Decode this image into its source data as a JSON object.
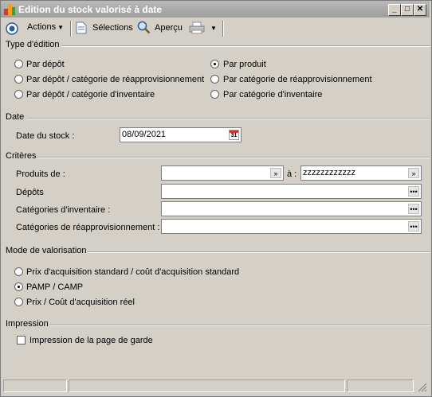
{
  "window": {
    "title": "Edition du stock valorisé à date"
  },
  "toolbar": {
    "actions": "Actions",
    "selections": "Sélections",
    "apercu": "Aperçu"
  },
  "type_edition": {
    "label": "Type d'édition",
    "options": [
      {
        "label": "Par dépôt",
        "checked": false
      },
      {
        "label": "Par dépôt / catégorie de réapprovisionnement",
        "checked": false
      },
      {
        "label": "Par dépôt / catégorie d'inventaire",
        "checked": false
      },
      {
        "label": "Par produit",
        "checked": true
      },
      {
        "label": "Par catégorie de réapprovisionnement",
        "checked": false
      },
      {
        "label": "Par catégorie d'inventaire",
        "checked": false
      }
    ]
  },
  "date": {
    "label": "Date",
    "field_label": "Date du stock :",
    "value": "08/09/2021",
    "calendar_text": "31"
  },
  "criteres": {
    "label": "Critères",
    "produits_label": "Produits de :",
    "produits_from": "",
    "a_label": "à :",
    "produits_to": "zzzzzzzzzzzz",
    "depots_label": "Dépôts",
    "depots_value": "",
    "cat_inv_label": "Catégories d'inventaire :",
    "cat_inv_value": "",
    "cat_reappro_label": "Catégories de réapprovisionnement :",
    "cat_reappro_value": "",
    "ellipsis": "•••"
  },
  "valorisation": {
    "label": "Mode de valorisation",
    "options": [
      {
        "label": "Prix d'acquisition standard / coût d'acquisition standard",
        "checked": false
      },
      {
        "label": "PAMP / CAMP",
        "checked": true
      },
      {
        "label": "Prix / Coût d'acquisition réel",
        "checked": false
      }
    ]
  },
  "impression": {
    "label": "Impression",
    "checkbox_label": "Impression de la page de garde",
    "checked": false
  }
}
